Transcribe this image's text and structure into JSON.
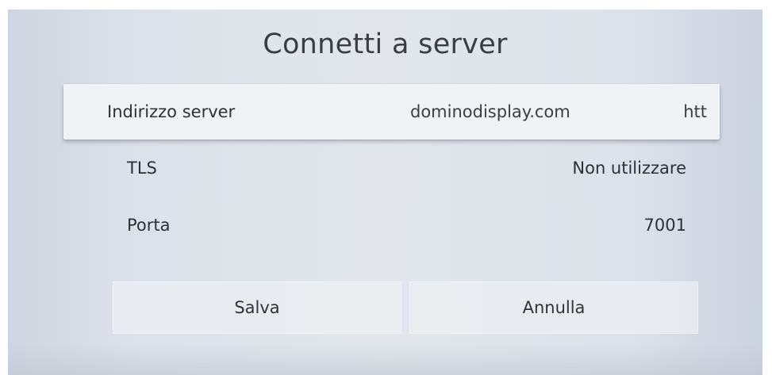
{
  "dialog": {
    "title": "Connetti a server"
  },
  "fields": [
    {
      "label": "Indirizzo server",
      "value": "dominodisplay.com",
      "extra": "htt"
    },
    {
      "label": "TLS",
      "value": "Non utilizzare"
    },
    {
      "label": "Porta",
      "value": "7001"
    }
  ],
  "buttons": {
    "save": "Salva",
    "cancel": "Annulla"
  }
}
